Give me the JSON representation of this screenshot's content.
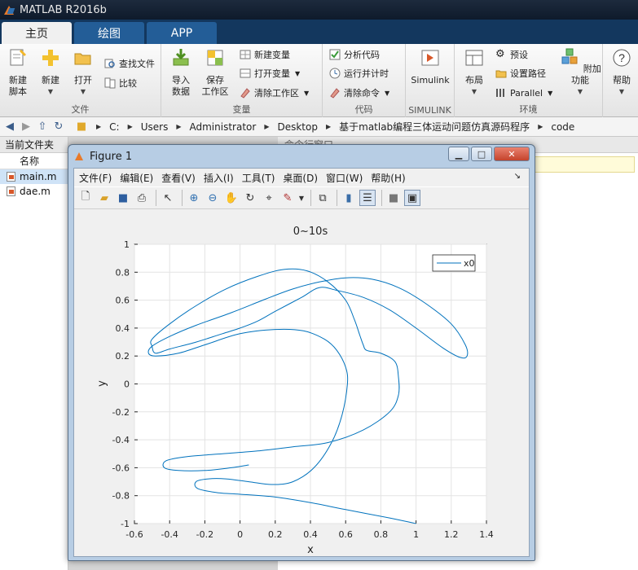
{
  "app": {
    "title": "MATLAB R2016b"
  },
  "tabs": [
    {
      "label": "主页"
    },
    {
      "label": "绘图"
    },
    {
      "label": "APP"
    }
  ],
  "ribbon": {
    "file_group": {
      "label": "文件",
      "new_script": "新建\n脚本",
      "new": "新建",
      "open": "打开",
      "find_files": "查找文件",
      "compare": "比较"
    },
    "variable_group": {
      "label": "变量",
      "import": "导入\n数据",
      "save_ws": "保存\n工作区",
      "new_var": "新建变量",
      "open_var": "打开变量",
      "clear_ws": "清除工作区"
    },
    "code_group": {
      "label": "代码",
      "analyze": "分析代码",
      "run_time": "运行并计时",
      "clear_cmd": "清除命令"
    },
    "simulink_group": {
      "label": "SIMULINK",
      "simulink": "Simulink"
    },
    "env_group": {
      "label": "环境",
      "layout": "布局",
      "prefs": "预设",
      "set_path": "设置路径",
      "parallel": "Parallel",
      "addons": "附加功能"
    },
    "help": "帮助"
  },
  "address": {
    "crumbs": [
      "C:",
      "Users",
      "Administrator",
      "Desktop",
      "基于matlab编程三体运动问题仿真源码程序",
      "code"
    ]
  },
  "file_panel": {
    "title": "当前文件夹",
    "column": "名称",
    "files": [
      "main.m",
      "dae.m"
    ]
  },
  "cmd_panel": {
    "title": "命令行窗口"
  },
  "figure": {
    "title": "Figure 1",
    "menu": [
      "文件(F)",
      "编辑(E)",
      "查看(V)",
      "插入(I)",
      "工具(T)",
      "桌面(D)",
      "窗口(W)",
      "帮助(H)"
    ]
  },
  "chart_data": {
    "type": "line",
    "title": "0~10s",
    "xlabel": "x",
    "ylabel": "y",
    "xlim": [
      -0.6,
      1.4
    ],
    "ylim": [
      -1,
      1
    ],
    "xticks": [
      "-0.6",
      "-0.4",
      "-0.2",
      "0",
      "0.2",
      "0.4",
      "0.6",
      "0.8",
      "1",
      "1.2",
      "1.4"
    ],
    "yticks": [
      "1",
      "0.8",
      "0.6",
      "0.4",
      "0.2",
      "0",
      "-0.2",
      "-0.4",
      "-0.6",
      "-0.8",
      "-1"
    ],
    "grid": true,
    "legend_position": "top-right",
    "series": [
      {
        "name": "x0",
        "color": "#0072bd",
        "points": [
          [
            1.0,
            -1.0
          ],
          [
            0.85,
            -0.96
          ],
          [
            0.6,
            -0.9
          ],
          [
            0.4,
            -0.85
          ],
          [
            0.2,
            -0.81
          ],
          [
            0.0,
            -0.79
          ],
          [
            -0.12,
            -0.78
          ],
          [
            -0.24,
            -0.75
          ],
          [
            -0.25,
            -0.7
          ],
          [
            -0.18,
            -0.68
          ],
          [
            -0.08,
            -0.68
          ],
          [
            0.05,
            -0.7
          ],
          [
            0.18,
            -0.72
          ],
          [
            0.3,
            -0.7
          ],
          [
            0.42,
            -0.6
          ],
          [
            0.52,
            -0.42
          ],
          [
            0.58,
            -0.22
          ],
          [
            0.61,
            0.0
          ],
          [
            0.6,
            0.12
          ],
          [
            0.55,
            0.24
          ],
          [
            0.48,
            0.32
          ],
          [
            0.36,
            0.38
          ],
          [
            0.2,
            0.39
          ],
          [
            0.0,
            0.36
          ],
          [
            -0.2,
            0.28
          ],
          [
            -0.35,
            0.22
          ],
          [
            -0.48,
            0.2
          ],
          [
            -0.52,
            0.22
          ],
          [
            -0.5,
            0.27
          ],
          [
            -0.4,
            0.34
          ],
          [
            -0.25,
            0.42
          ],
          [
            -0.05,
            0.51
          ],
          [
            0.15,
            0.61
          ],
          [
            0.3,
            0.68
          ],
          [
            0.45,
            0.73
          ],
          [
            0.6,
            0.76
          ],
          [
            0.75,
            0.75
          ],
          [
            0.9,
            0.69
          ],
          [
            1.05,
            0.58
          ],
          [
            1.2,
            0.43
          ],
          [
            1.28,
            0.28
          ],
          [
            1.29,
            0.2
          ],
          [
            1.25,
            0.19
          ],
          [
            1.15,
            0.26
          ],
          [
            1.0,
            0.4
          ],
          [
            0.85,
            0.53
          ],
          [
            0.7,
            0.62
          ],
          [
            0.55,
            0.67
          ],
          [
            0.45,
            0.69
          ],
          [
            0.35,
            0.62
          ],
          [
            0.2,
            0.52
          ],
          [
            0.1,
            0.45
          ],
          [
            0.0,
            0.4
          ],
          [
            -0.1,
            0.36
          ],
          [
            -0.25,
            0.3
          ],
          [
            -0.4,
            0.25
          ],
          [
            -0.48,
            0.22
          ],
          [
            -0.5,
            0.27
          ],
          [
            -0.5,
            0.32
          ],
          [
            -0.4,
            0.43
          ],
          [
            -0.25,
            0.56
          ],
          [
            -0.08,
            0.68
          ],
          [
            0.1,
            0.77
          ],
          [
            0.25,
            0.82
          ],
          [
            0.38,
            0.81
          ],
          [
            0.5,
            0.73
          ],
          [
            0.6,
            0.6
          ],
          [
            0.65,
            0.46
          ],
          [
            0.68,
            0.35
          ],
          [
            0.7,
            0.28
          ],
          [
            0.72,
            0.24
          ],
          [
            0.8,
            0.22
          ],
          [
            0.88,
            0.16
          ],
          [
            0.9,
            0.05
          ],
          [
            0.9,
            -0.08
          ],
          [
            0.85,
            -0.2
          ],
          [
            0.7,
            -0.33
          ],
          [
            0.5,
            -0.42
          ],
          [
            0.3,
            -0.45
          ],
          [
            0.1,
            -0.48
          ],
          [
            -0.1,
            -0.5
          ],
          [
            -0.3,
            -0.52
          ],
          [
            -0.42,
            -0.55
          ],
          [
            -0.43,
            -0.6
          ],
          [
            -0.35,
            -0.62
          ],
          [
            -0.2,
            -0.62
          ],
          [
            -0.05,
            -0.6
          ],
          [
            0.05,
            -0.58
          ]
        ]
      }
    ]
  }
}
